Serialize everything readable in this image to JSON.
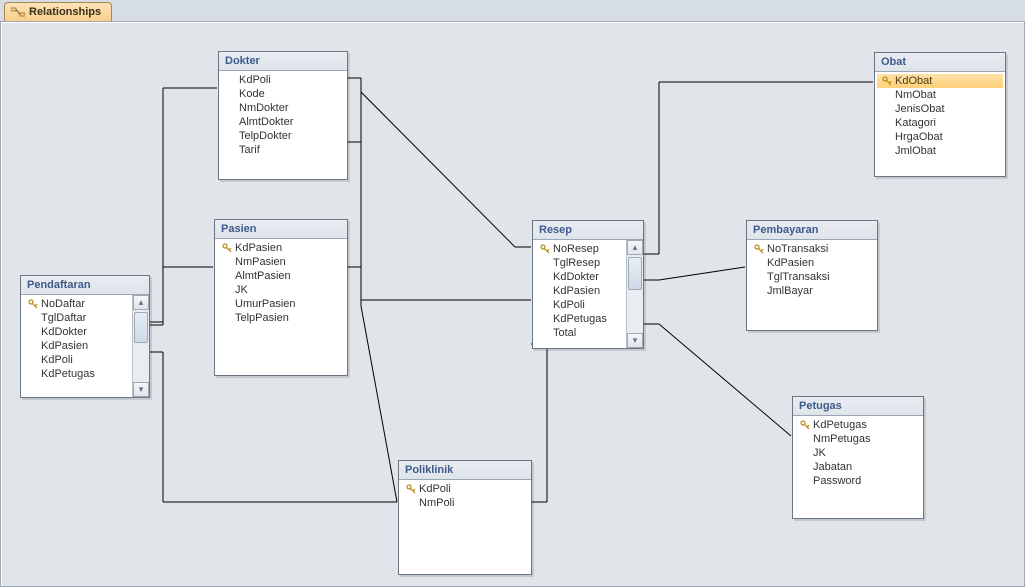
{
  "tab": {
    "label": "Relationships"
  },
  "tables": {
    "pendaftaran": {
      "title": "Pendaftaran",
      "fields": [
        "NoDaftar",
        "TglDaftar",
        "KdDokter",
        "KdPasien",
        "KdPoli",
        "KdPetugas"
      ],
      "keys": [
        true,
        false,
        false,
        false,
        false,
        false
      ],
      "scroll": true
    },
    "dokter": {
      "title": "Dokter",
      "fields": [
        "KdPoli",
        "Kode",
        "NmDokter",
        "AlmtDokter",
        "TelpDokter",
        "Tarif"
      ],
      "keys": [
        false,
        false,
        false,
        false,
        false,
        false
      ]
    },
    "pasien": {
      "title": "Pasien",
      "fields": [
        "KdPasien",
        "NmPasien",
        "AlmtPasien",
        "JK",
        "UmurPasien",
        "TelpPasien"
      ],
      "keys": [
        true,
        false,
        false,
        false,
        false,
        false
      ]
    },
    "poliklinik": {
      "title": "Poliklinik",
      "fields": [
        "KdPoli",
        "NmPoli"
      ],
      "keys": [
        true,
        false
      ]
    },
    "resep": {
      "title": "Resep",
      "fields": [
        "NoResep",
        "TglResep",
        "KdDokter",
        "KdPasien",
        "KdPoli",
        "KdPetugas",
        "Total"
      ],
      "keys": [
        true,
        false,
        false,
        false,
        false,
        false,
        false
      ],
      "scroll": true
    },
    "obat": {
      "title": "Obat",
      "fields": [
        "KdObat",
        "NmObat",
        "JenisObat",
        "Katagori",
        "HrgaObat",
        "JmlObat"
      ],
      "keys": [
        true,
        false,
        false,
        false,
        false,
        false
      ],
      "selected": 0
    },
    "pembayaran": {
      "title": "Pembayaran",
      "fields": [
        "NoTransaksi",
        "KdPasien",
        "TglTransaksi",
        "JmlBayar"
      ],
      "keys": [
        true,
        false,
        false,
        false
      ]
    },
    "petugas": {
      "title": "Petugas",
      "fields": [
        "KdPetugas",
        "NmPetugas",
        "JK",
        "Jabatan",
        "Password"
      ],
      "keys": [
        true,
        false,
        false,
        false,
        false
      ]
    }
  }
}
